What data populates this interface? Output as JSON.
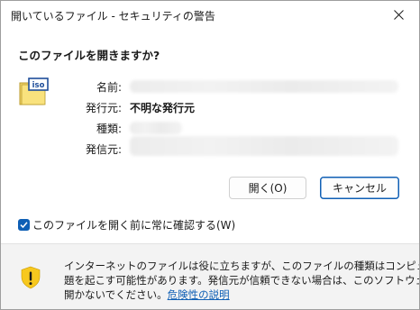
{
  "window": {
    "title": "開いているファイル - セキュリティの警告",
    "close_icon": "close-icon"
  },
  "dialog": {
    "heading": "このファイルを開きますか?",
    "file_icon": "iso-file-icon",
    "file_icon_text": "iso",
    "fields": [
      {
        "label": "名前:",
        "value": ""
      },
      {
        "label": "発行元:",
        "value": "不明な発行元"
      },
      {
        "label": "種類:",
        "value": ""
      },
      {
        "label": "発信元:",
        "value": ""
      }
    ]
  },
  "buttons": {
    "open": "開く(O)",
    "cancel": "キャンセル"
  },
  "checkbox": {
    "label": "このファイルを開く前に常に確認する(W)",
    "checked": true
  },
  "footer": {
    "icon": "warning-shield-icon",
    "line1": "インターネットのファイルは役に立ちますが、このファイルの種類はコンピューターに問",
    "line2": "題を起こす可能性があります。発信元が信頼できない場合は、このソフトウェアを",
    "line3_prefix": "開かないでください。",
    "link": "危険性の説明"
  },
  "colors": {
    "accent": "#0f5fb5",
    "footer_bg": "#f3f3f3",
    "shield_yellow": "#f7c81e"
  }
}
